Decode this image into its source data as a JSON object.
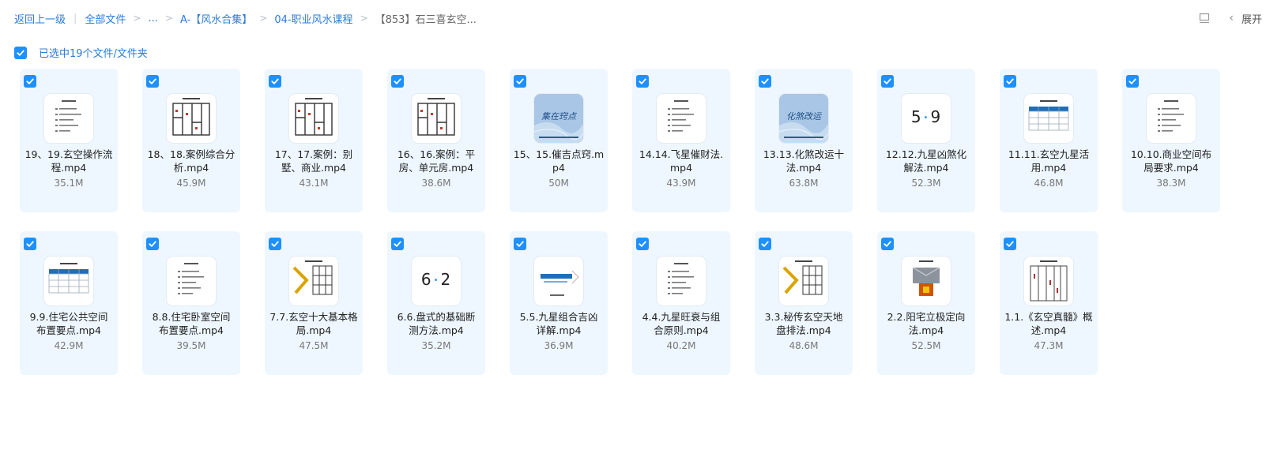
{
  "breadcrumb": {
    "back_label": "返回上一级",
    "root_label": "全部文件",
    "ellipsis": "...",
    "folder1": "A-【风水合集】",
    "folder2": "04-职业风水课程",
    "current": "【853】石三喜玄空..."
  },
  "toolbar": {
    "layout_icon": "layout-icon",
    "expand_label": "展开"
  },
  "selection": {
    "label": "已选中19个文件/文件夹"
  },
  "files": [
    {
      "line1": "19、19.玄空操作流",
      "line2": "程.mp4",
      "size": "35.1M",
      "thumb": "doc"
    },
    {
      "line1": "18、18.案例综合分",
      "line2": "析.mp4",
      "size": "45.9M",
      "thumb": "plan"
    },
    {
      "line1": "17、17.案例：别",
      "line2": "墅、商业.mp4",
      "size": "43.1M",
      "thumb": "plan"
    },
    {
      "line1": "16、16.案例：平",
      "line2": "房、单元房.mp4",
      "size": "38.6M",
      "thumb": "plan"
    },
    {
      "line1": "15、15.催吉点窍.m",
      "line2": "p4",
      "size": "50M",
      "thumb": "cover",
      "cover_text": "集在窍点"
    },
    {
      "line1": "14.14.飞星催财法.",
      "line2": "mp4",
      "size": "43.9M",
      "thumb": "doc"
    },
    {
      "line1": "13.13.化煞改运十",
      "line2": "法.mp4",
      "size": "63.8M",
      "thumb": "cover",
      "cover_text": "化煞改运"
    },
    {
      "line1": "12.12.九星凶煞化",
      "line2": "解法.mp4",
      "size": "52.3M",
      "thumb": "digits",
      "d1": "5",
      "d2": "9"
    },
    {
      "line1": "11.11.玄空九星活",
      "line2": "用.mp4",
      "size": "46.8M",
      "thumb": "table"
    },
    {
      "line1": "10.10.商业空间布",
      "line2": "局要求.mp4",
      "size": "38.3M",
      "thumb": "doc"
    },
    {
      "line1": "9.9.住宅公共空间",
      "line2": "布置要点.mp4",
      "size": "42.9M",
      "thumb": "table"
    },
    {
      "line1": "8.8.住宅卧室空间",
      "line2": "布置要点.mp4",
      "size": "39.5M",
      "thumb": "doc"
    },
    {
      "line1": "7.7.玄空十大基本格",
      "line2": "局.mp4",
      "size": "47.5M",
      "thumb": "luopan"
    },
    {
      "line1": "6.6.盘式的基础断",
      "line2": "测方法.mp4",
      "size": "35.2M",
      "thumb": "digits",
      "d1": "6",
      "d2": "2"
    },
    {
      "line1": "5.5.九星组合吉凶",
      "line2": "详解.mp4",
      "size": "36.9M",
      "thumb": "bluetext"
    },
    {
      "line1": "4.4.九星旺衰与组",
      "line2": "合原则.mp4",
      "size": "40.2M",
      "thumb": "doc"
    },
    {
      "line1": "3.3.秘传玄空天地",
      "line2": "盘排法.mp4",
      "size": "48.6M",
      "thumb": "luopan"
    },
    {
      "line1": "2.2.阳宅立极定向",
      "line2": "法.mp4",
      "size": "52.5M",
      "thumb": "redbox"
    },
    {
      "line1": "1.1.《玄空真髓》概",
      "line2": "述.mp4",
      "size": "47.3M",
      "thumb": "columns"
    }
  ],
  "colors": {
    "accent": "#1e90ff",
    "card_bg": "#eef7ff",
    "link": "#2d7cd6"
  }
}
